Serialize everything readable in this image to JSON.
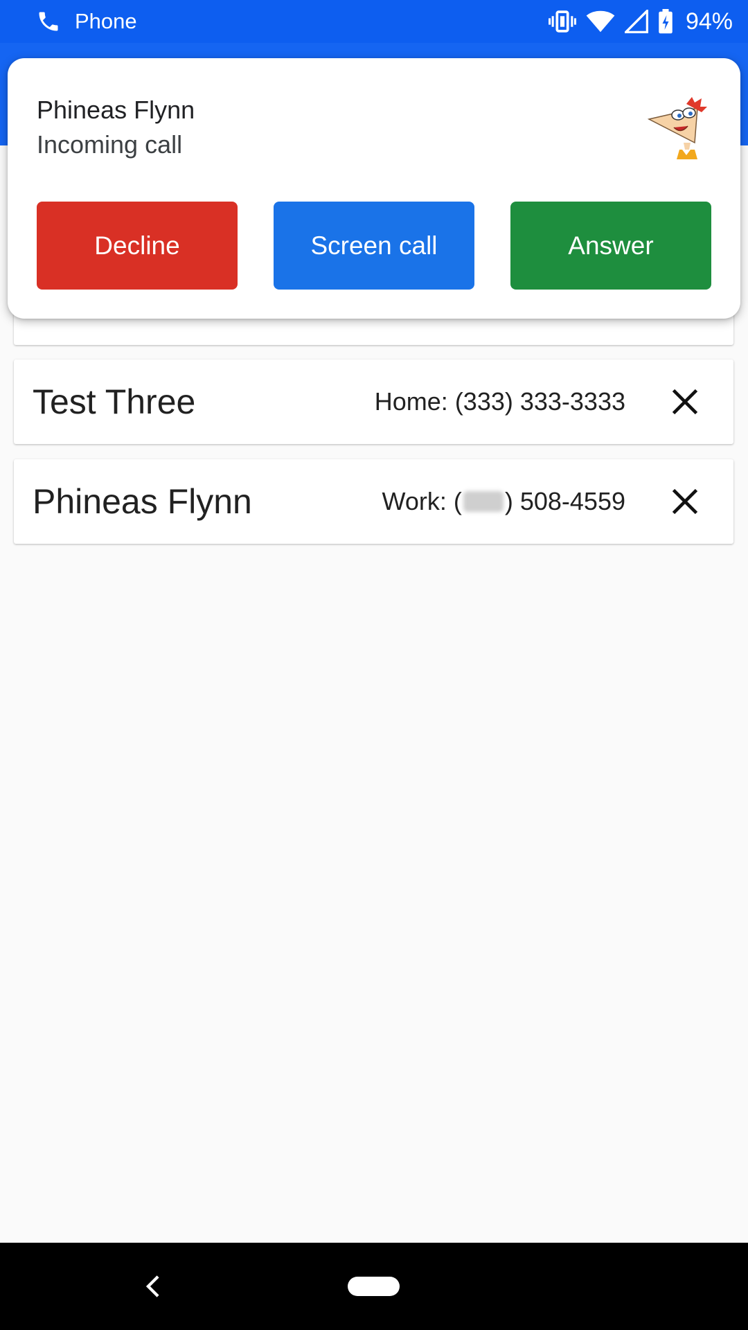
{
  "status_bar": {
    "app_label": "Phone",
    "battery": "94%",
    "icons": [
      "phone-icon",
      "vibrate-icon",
      "wifi-icon",
      "signal-icon",
      "battery-charging-icon"
    ]
  },
  "notification": {
    "caller_name": "Phineas Flynn",
    "status": "Incoming call",
    "avatar_icon": "caller-avatar",
    "buttons": {
      "decline": "Decline",
      "screen": "Screen call",
      "answer": "Answer"
    },
    "colors": {
      "decline": "#d93025",
      "screen": "#1a73e8",
      "answer": "#1e8e3e"
    }
  },
  "contacts": [
    {
      "name": "Test Three",
      "phone": "Home: (333) 333-3333",
      "remove_icon": "close-icon"
    },
    {
      "name": "Phineas Flynn",
      "phone_prefix": "Work: (",
      "phone_suffix": ") 508-4559",
      "remove_icon": "close-icon"
    }
  ],
  "nav_bar": {
    "icons": [
      "back-icon",
      "home-pill"
    ]
  },
  "colors": {
    "status_bar": "#0d5ef0",
    "app_bar": "#1565f2",
    "background": "#fafafa"
  }
}
